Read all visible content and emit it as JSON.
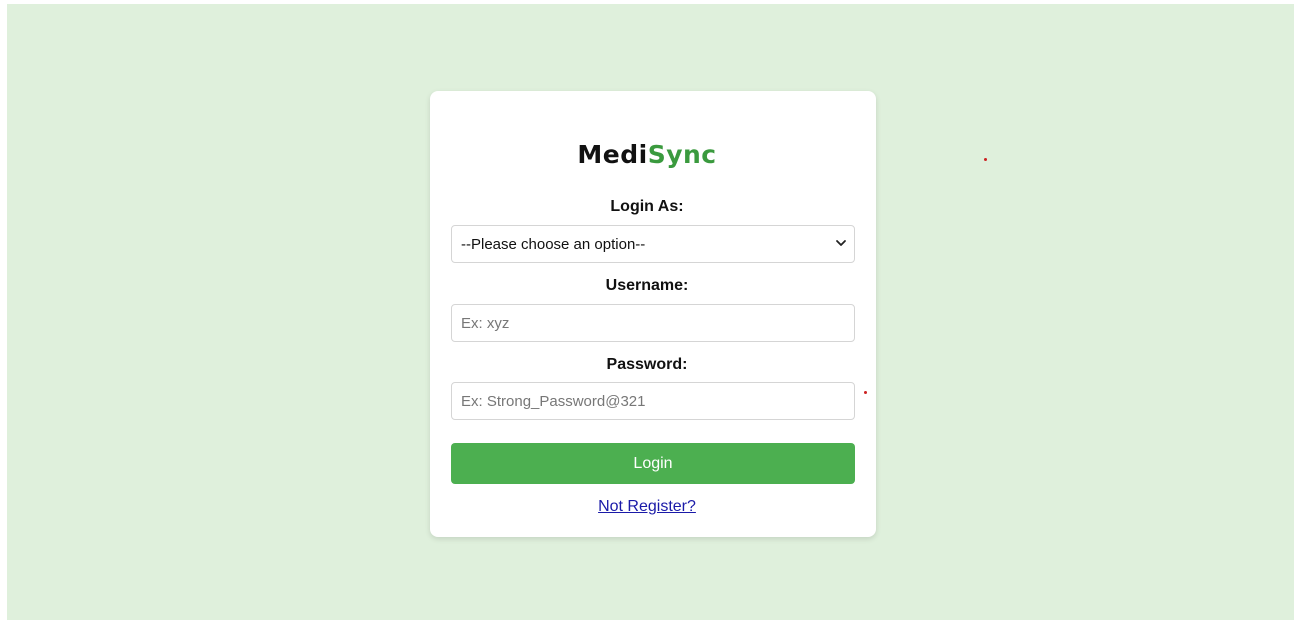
{
  "brand": {
    "prefix": "Medi",
    "accent": "Sync"
  },
  "form": {
    "login_as_label": "Login As:",
    "role_select_value": "--Please choose an option--",
    "username_label": "Username:",
    "username_placeholder": "Ex: xyz",
    "username_value": "",
    "password_label": "Password:",
    "password_placeholder": "Ex: Strong_Password@321",
    "password_value": "",
    "login_button": "Login",
    "register_link": "Not Register?"
  },
  "colors": {
    "page_background": "#dff0dc",
    "card_background": "#ffffff",
    "brand_accent": "#3a9a3e",
    "button": "#4caf50",
    "link": "#1a1aa8",
    "required_marker": "#cc2222"
  },
  "icons": {
    "select_chevron": "chevron-down-icon"
  }
}
